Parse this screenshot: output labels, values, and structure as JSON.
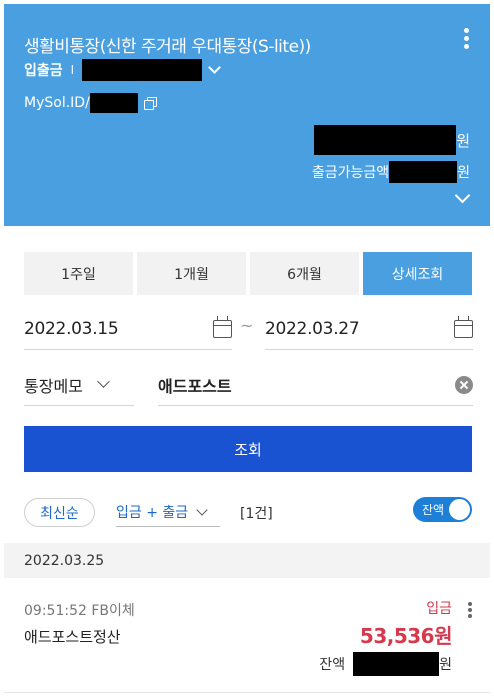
{
  "account": {
    "name": "생활비통장(신한 주거래 우대통장(S-lite))",
    "type": "입출금",
    "separator": "I",
    "mysol_prefix": "MySol.ID/",
    "balance_unit": "원",
    "available_label": "출금가능금액",
    "available_unit": "원"
  },
  "period_tabs": [
    {
      "label": "1주일",
      "active": false
    },
    {
      "label": "1개월",
      "active": false
    },
    {
      "label": "6개월",
      "active": false
    },
    {
      "label": "상세조회",
      "active": true
    }
  ],
  "date_range": {
    "from": "2022.03.15",
    "separator": "~",
    "to": "2022.03.27"
  },
  "memo_filter": {
    "selected": "통장메모",
    "value": "애드포스트"
  },
  "search_button": "조회",
  "list_controls": {
    "sort": "최신순",
    "type_filter": "입금 + 출금",
    "count": "[1건]",
    "balance_toggle_label": "잔액",
    "balance_toggle_on": true
  },
  "transactions": [
    {
      "date": "2022.03.25",
      "time_method": "09:51:52 FB이체",
      "description": "애드포스트정산",
      "type": "입금",
      "amount": "53,536원",
      "balance_label": "잔액",
      "balance_unit": "원"
    }
  ],
  "colors": {
    "header_bg": "#4a9fe0",
    "primary_button": "#1a53d1",
    "deposit_red": "#d5394d",
    "link_blue": "#1d68c9"
  },
  "icons": [
    "more-vertical-icon",
    "chevron-down-icon",
    "copy-icon",
    "calendar-icon",
    "clear-icon"
  ]
}
